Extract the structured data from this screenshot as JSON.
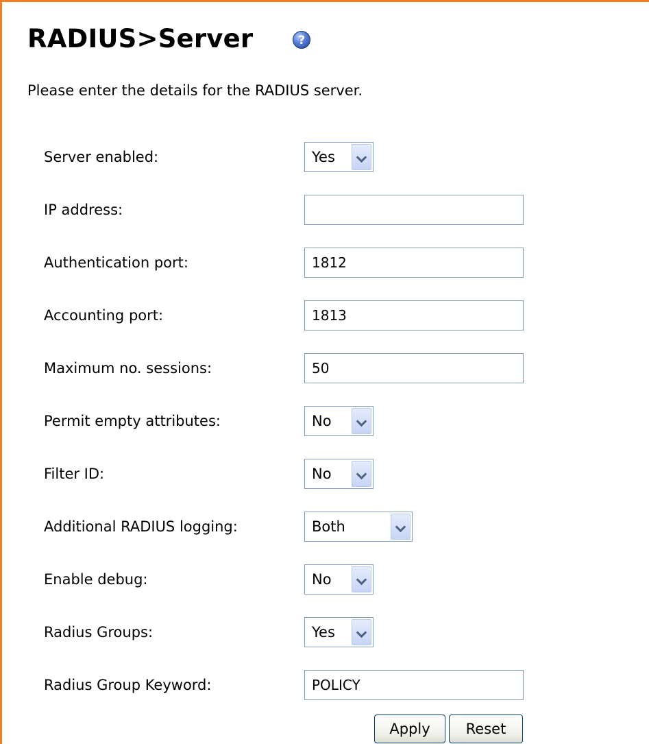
{
  "page": {
    "title": "RADIUS>Server",
    "help_icon": "help-icon",
    "help_glyph": "?",
    "intro": "Please enter the details for the RADIUS server.",
    "accent_color": "#ef7e24"
  },
  "form": {
    "server_enabled": {
      "label": "Server enabled:",
      "value": "Yes"
    },
    "ip_address": {
      "label": "IP address:",
      "value": ""
    },
    "auth_port": {
      "label": "Authentication port:",
      "value": "1812"
    },
    "acct_port": {
      "label": "Accounting port:",
      "value": "1813"
    },
    "max_sessions": {
      "label": "Maximum no. sessions:",
      "value": "50"
    },
    "permit_empty": {
      "label": "Permit empty attributes:",
      "value": "No"
    },
    "filter_id": {
      "label": "Filter ID:",
      "value": "No"
    },
    "logging": {
      "label": "Additional RADIUS logging:",
      "value": "Both"
    },
    "debug": {
      "label": "Enable debug:",
      "value": "No"
    },
    "groups": {
      "label": "Radius Groups:",
      "value": "Yes"
    },
    "group_keyword": {
      "label": "Radius Group Keyword:",
      "value": "POLICY"
    }
  },
  "buttons": {
    "apply": "Apply",
    "reset": "Reset"
  }
}
